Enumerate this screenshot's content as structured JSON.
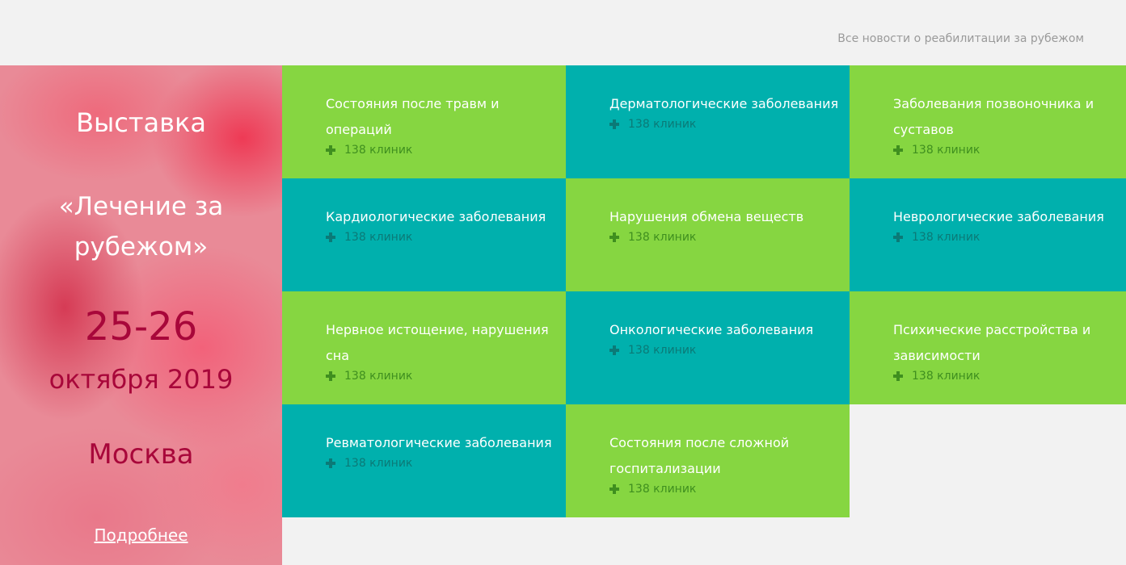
{
  "header": {
    "news_link": "Все новости о реабилитации за рубежом"
  },
  "promo": {
    "title": "Выставка",
    "name": "«Лечение за рубежом»",
    "dates": "25-26",
    "month": "октября 2019",
    "city": "Москва",
    "more_link": "Подробнее"
  },
  "colors": {
    "green": "#86d641",
    "teal": "#00b0ad",
    "promo_accent": "#a8073a"
  },
  "categories": [
    {
      "title": "Состояния после травм и операций",
      "count": "138 клиник",
      "color": "green",
      "icon": "plus-icon"
    },
    {
      "title": "Дерматологические заболевания",
      "count": "138 клиник",
      "color": "teal",
      "icon": "plus-icon"
    },
    {
      "title": "Заболевания позвоночника и суставов",
      "count": "138 клиник",
      "color": "green",
      "icon": "plus-icon"
    },
    {
      "title": "Кардиологические заболевания",
      "count": "138 клиник",
      "color": "teal",
      "icon": "plus-icon"
    },
    {
      "title": "Нарушения обмена веществ",
      "count": "138 клиник",
      "color": "green",
      "icon": "plus-icon"
    },
    {
      "title": "Неврологические заболевания",
      "count": "138 клиник",
      "color": "teal",
      "icon": "plus-icon"
    },
    {
      "title": "Нервное истощение, нарушения сна",
      "count": "138 клиник",
      "color": "green",
      "icon": "plus-icon"
    },
    {
      "title": "Онкологические заболевания",
      "count": "138 клиник",
      "color": "teal",
      "icon": "plus-icon"
    },
    {
      "title": "Психические расстройства и зависимости",
      "count": "138 клиник",
      "color": "green",
      "icon": "plus-icon"
    },
    {
      "title": "Ревматологические заболевания",
      "count": "138 клиник",
      "color": "teal",
      "icon": "plus-icon"
    },
    {
      "title": "Состояния после сложной госпитализации",
      "count": "138 клиник",
      "color": "green",
      "icon": "plus-icon"
    }
  ]
}
